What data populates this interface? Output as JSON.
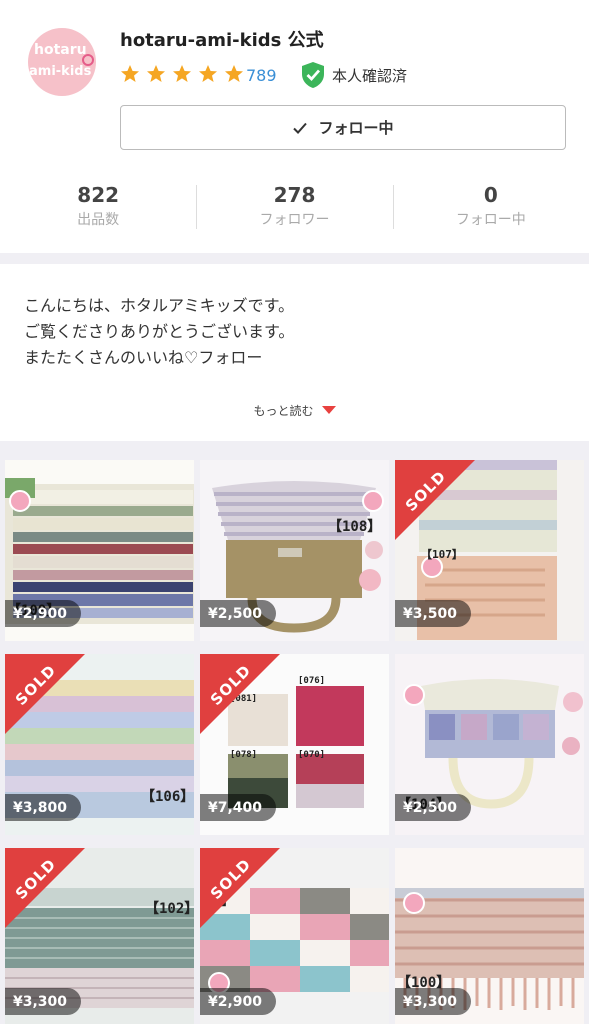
{
  "shop": {
    "avatar_line1": "hotaru",
    "avatar_line2": "ami-kids",
    "name": "hotaru-ami-kids 公式",
    "rating_count": "789",
    "verified_label": "本人確認済",
    "follow_label": "フォロー中"
  },
  "stats": [
    {
      "value": "822",
      "label": "出品数"
    },
    {
      "value": "278",
      "label": "フォロワー"
    },
    {
      "value": "0",
      "label": "フォロー中"
    }
  ],
  "intro": {
    "lines": [
      "こんにちは、ホタルアミキッズです。",
      "ご覧くださりありがとうございます。",
      "またたくさんのいいね♡フォロー"
    ],
    "more_label": "もっと読む"
  },
  "items": [
    {
      "price": "¥2,900",
      "tag": "【109】",
      "sold": false
    },
    {
      "price": "¥2,500",
      "tag": "【108】",
      "sold": false
    },
    {
      "price": "¥3,500",
      "tag": "【107】",
      "sold": true
    },
    {
      "price": "¥3,800",
      "tag": "【106】",
      "sold": true
    },
    {
      "price": "¥7,400",
      "tag": "",
      "sold": true,
      "sub_tags": [
        "[081]",
        "[076]",
        "[078]",
        "[070]"
      ]
    },
    {
      "price": "¥2,500",
      "tag": "【104】",
      "sold": false
    },
    {
      "price": "¥3,300",
      "tag": "【102】",
      "sold": true
    },
    {
      "price": "¥2,900",
      "tag": "01】",
      "sold": true
    },
    {
      "price": "¥3,300",
      "tag": "【100】",
      "sold": false
    }
  ],
  "sold_label": "SOLD",
  "colors": {
    "accent": "#e0403f",
    "star": "#f5a623",
    "link": "#3a8fd6",
    "verified": "#3cb55a"
  }
}
